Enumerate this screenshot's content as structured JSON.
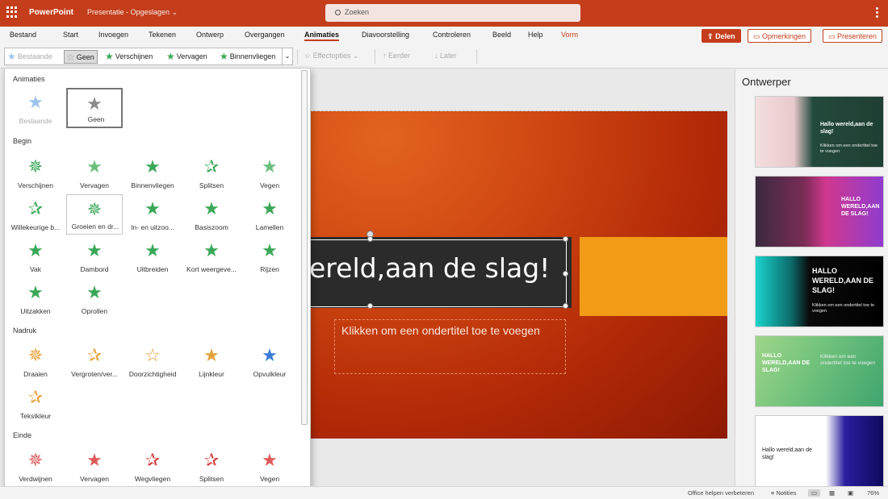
{
  "app": {
    "name": "PowerPoint",
    "doc_title": "Presentatie - Opgeslagen",
    "search_placeholder": "Zoeken",
    "brand_color": "#c43e1c"
  },
  "menu": {
    "tabs": [
      "Bestand",
      "Start",
      "Invoegen",
      "Tekenen",
      "Ontwerp",
      "Overgangen",
      "Animaties",
      "Diavoorstelling",
      "Controleren",
      "Beeld",
      "Help",
      "Vorm"
    ],
    "active": "Animaties",
    "share": "Delen",
    "comments": "Opmerkingen",
    "present": "Presenteren"
  },
  "ribbon": {
    "gallery": [
      "Bestaande",
      "Geen",
      "Verschijnen",
      "Vervagen",
      "Binnenvliegen"
    ],
    "effect_options": "Effectopties",
    "earlier": "Eerder",
    "later": "Later"
  },
  "animations_panel": {
    "sections": {
      "animaties": {
        "label": "Animaties",
        "items": [
          {
            "label": "Bestaande",
            "icon": "star-blue",
            "state": "disabled"
          },
          {
            "label": "Geen",
            "icon": "star-gray",
            "state": "selected"
          }
        ]
      },
      "begin": {
        "label": "Begin",
        "items": [
          {
            "label": "Verschijnen",
            "icon": "star-green"
          },
          {
            "label": "Vervagen",
            "icon": "star-green"
          },
          {
            "label": "Binnenvliegen",
            "icon": "star-green"
          },
          {
            "label": "Splitsen",
            "icon": "star-green"
          },
          {
            "label": "Vegen",
            "icon": "star-green"
          },
          {
            "label": "Willekeurige b...",
            "icon": "star-green"
          },
          {
            "label": "Groeien en dr...",
            "icon": "star-green",
            "state": "hover"
          },
          {
            "label": "In- en uitzoo...",
            "icon": "star-green"
          },
          {
            "label": "Basiszoom",
            "icon": "star-green"
          },
          {
            "label": "Lamellen",
            "icon": "star-green"
          },
          {
            "label": "Vak",
            "icon": "star-green"
          },
          {
            "label": "Dambord",
            "icon": "star-green"
          },
          {
            "label": "Uitbreiden",
            "icon": "star-green"
          },
          {
            "label": "Kort weergeve...",
            "icon": "star-green"
          },
          {
            "label": "Rijzen",
            "icon": "star-green"
          },
          {
            "label": "Uitzakken",
            "icon": "star-green"
          },
          {
            "label": "Oprollen",
            "icon": "star-green"
          }
        ]
      },
      "nadruk": {
        "label": "Nadruk",
        "items": [
          {
            "label": "Draaien",
            "icon": "star-orange"
          },
          {
            "label": "Vergroten/ver...",
            "icon": "star-orange"
          },
          {
            "label": "Doorzichtigheid",
            "icon": "star-orange"
          },
          {
            "label": "Lijnkleur",
            "icon": "star-orange"
          },
          {
            "label": "Opvulkleur",
            "icon": "star-orange"
          },
          {
            "label": "Tekstkleur",
            "icon": "star-orange"
          }
        ]
      },
      "einde": {
        "label": "Einde",
        "items": [
          {
            "label": "Verdwijnen",
            "icon": "star-red"
          },
          {
            "label": "Vervagen",
            "icon": "star-red"
          },
          {
            "label": "Wegvliegen",
            "icon": "star-red"
          },
          {
            "label": "Splitsen",
            "icon": "star-red"
          },
          {
            "label": "Vegen",
            "icon": "star-red"
          }
        ]
      }
    }
  },
  "slide": {
    "title": "ereld,aan de slag!",
    "subtitle": "Klikken om een ondertitel toe te voegen"
  },
  "designer": {
    "title": "Ontwerper",
    "thumbs": [
      {
        "title": "Hallo wereld,aan de slag!",
        "sub": "Klikken om een ondertitel toe te voegen"
      },
      {
        "title": "HALLO WERELD,AAN DE SLAG!",
        "sub": ""
      },
      {
        "title": "HALLO WERELD,AAN DE SLAG!",
        "sub": "Klikken om een ondertitel toe te voegen"
      },
      {
        "title": "HALLO WERELD,AAN DE SLAG!",
        "sub": "Klikken om een ondertitel toe te voegen"
      },
      {
        "title": "Hallo wereld,aan de slag!",
        "sub": ""
      }
    ]
  },
  "status": {
    "help": "Office helpen verbeteren",
    "notes": "Notities",
    "zoom": "76%"
  }
}
